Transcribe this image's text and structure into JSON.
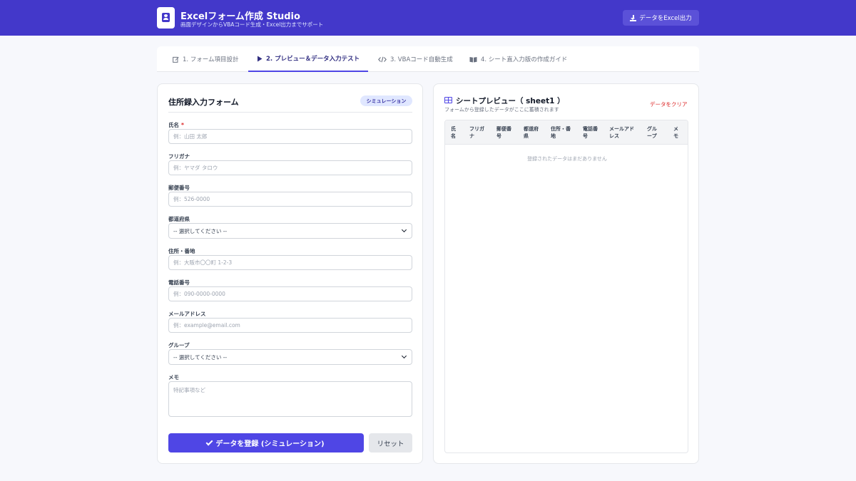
{
  "header": {
    "title": "Excelフォーム作成 Studio",
    "subtitle": "画面デザインからVBAコード生成・Excel出力までサポート",
    "export_label": "データをExcel出力"
  },
  "tabs": [
    {
      "label": "1. フォーム項目設計",
      "icon": "edit-icon",
      "active": false
    },
    {
      "label": "2. プレビュー＆データ入力テスト",
      "icon": "play-icon",
      "active": true
    },
    {
      "label": "3. VBAコード自動生成",
      "icon": "code-icon",
      "active": false
    },
    {
      "label": "4. シート直入力版の作成ガイド",
      "icon": "book-icon",
      "active": false
    }
  ],
  "form": {
    "title": "住所録入力フォーム",
    "badge": "シミュレーション",
    "fields": [
      {
        "label": "氏名",
        "required_mark": "*",
        "type": "text",
        "placeholder": "例：山田 太郎",
        "value": ""
      },
      {
        "label": "フリガナ",
        "type": "text",
        "placeholder": "例：ヤマダ タロウ",
        "value": ""
      },
      {
        "label": "郵便番号",
        "type": "text",
        "placeholder": "例：526-0000",
        "value": ""
      },
      {
        "label": "都道府県",
        "type": "select",
        "selected": "-- 選択してください --"
      },
      {
        "label": "住所・番地",
        "type": "text",
        "placeholder": "例：大阪市〇〇町 1-2-3",
        "value": ""
      },
      {
        "label": "電話番号",
        "type": "text",
        "placeholder": "例：090-0000-0000",
        "value": ""
      },
      {
        "label": "メールアドレス",
        "type": "text",
        "placeholder": "例：example@email.com",
        "value": ""
      },
      {
        "label": "グループ",
        "type": "select",
        "selected": "-- 選択してください --"
      },
      {
        "label": "メモ",
        "type": "textarea",
        "placeholder": "特記事項など",
        "value": ""
      }
    ],
    "submit_label": "データを登録 (シミュレーション)",
    "reset_label": "リセット"
  },
  "preview": {
    "title": "シートプレビュー（ sheet1 ）",
    "subtitle": "フォームから登録したデータがここに蓄積されます",
    "clear_label": "データをクリア",
    "columns": [
      "氏\n名",
      "フリガ\nナ",
      "郵便番\n号",
      "都道府\n県",
      "住所・番\n地",
      "電話番\n号",
      "メールアド\nレス",
      "グル\nープ",
      "メ\nモ"
    ],
    "empty_message": "登録されたデータはまだありません",
    "rows": []
  },
  "colors": {
    "header_bg": "#4338ca",
    "accent": "#4f46e5",
    "danger": "#dc2626",
    "badge_bg": "#e0e7ff"
  }
}
